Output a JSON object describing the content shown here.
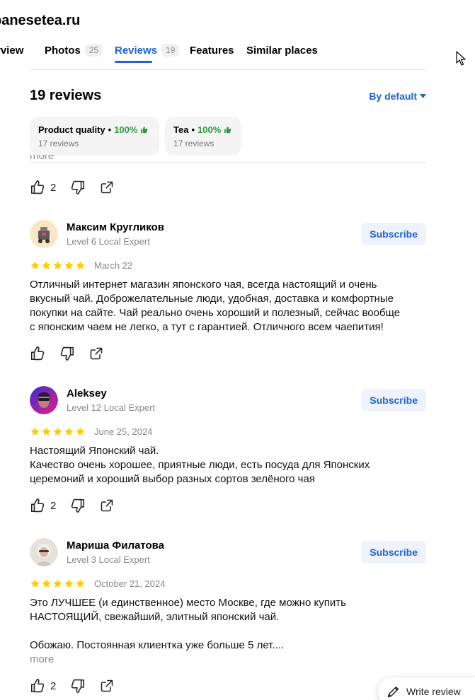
{
  "header": {
    "site_title": "panesetea.ru"
  },
  "tabs": [
    {
      "label": "rview",
      "count": ""
    },
    {
      "label": "Photos",
      "count": "25"
    },
    {
      "label": "Reviews",
      "count": "19"
    },
    {
      "label": "Features",
      "count": ""
    },
    {
      "label": "Similar places",
      "count": ""
    }
  ],
  "reviews_section": {
    "heading": "19 reviews",
    "sort_label": "By default",
    "aspects": [
      {
        "name": "Product quality",
        "percent": "100%",
        "count": "17 reviews"
      },
      {
        "name": "Tea",
        "percent": "100%",
        "count": "17 reviews"
      }
    ],
    "prev_more": "more",
    "prev_likes": "2"
  },
  "reviews": [
    {
      "author": "Максим Кругликов",
      "level": "Level 6 Local Expert",
      "subscribe": "Subscribe",
      "date": "March 22",
      "rating": 5,
      "text": "Отличный интернет магазин японского чая, всегда настоящий и очень\nвкусный чай. Доброжелательные люди, удобная, доставка и комфортные\nпокупки на сайте. Чай реально очень хороший и полезный, сейчас вообще\nс японским чаем не легко, а тут с гарантией. Отличного всем чаепития!",
      "likes": "",
      "more": ""
    },
    {
      "author": "Aleksey",
      "level": "Level 12 Local Expert",
      "subscribe": "Subscribe",
      "date": "June 25, 2024",
      "rating": 5,
      "text": "Настоящий Японский чай.\nКачество очень хорошее, приятные люди, есть посуда для Японских\nцеремоний и хороший выбор разных сортов зелёного чая",
      "likes": "2",
      "more": ""
    },
    {
      "author": "Мариша Филатова",
      "level": "Level 3 Local Expert",
      "subscribe": "Subscribe",
      "date": "October 21, 2024",
      "rating": 5,
      "text": "Это ЛУЧШЕЕ (и единственное) место Москве, где можно купить\nНАСТОЯЩИЙ, свежайший, элитный японский чай.\n\nОбожаю. Постоянная клиентка уже больше 5 лет....",
      "likes": "2",
      "more": "more"
    }
  ],
  "write_review": {
    "label": "Write review"
  },
  "colors": {
    "accent": "#1f61d3",
    "star": "#ffcc00",
    "green": "#2e9a3a",
    "muted": "#888888"
  }
}
